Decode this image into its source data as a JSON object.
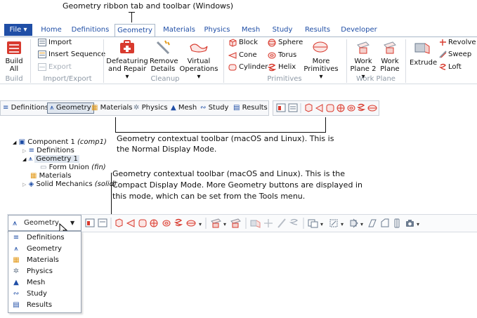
{
  "captions": {
    "top": "Geometry ribbon tab and toolbar (Windows)",
    "normal_line1": "Geometry contextual toolbar (macOS and Linux). This is",
    "normal_line2": "the Normal Display Mode.",
    "compact_line1": "Geometry contextual toolbar (macOS and Linux). This is the",
    "compact_line2": "Compact Display Mode. More Geometry buttons are displayed in",
    "compact_line3": "this mode, which can be set from the Tools menu."
  },
  "ribbon": {
    "file": "File ▾",
    "tabs": [
      "Home",
      "Definitions",
      "Geometry",
      "Materials",
      "Physics",
      "Mesh",
      "Study",
      "Results",
      "Developer"
    ],
    "build_all": [
      "Build",
      "All"
    ],
    "import": "Import",
    "insert_sequence": "Insert Sequence",
    "export": "Export",
    "defeaturing": [
      "Defeaturing",
      "and Repair ▾"
    ],
    "remove_details": [
      "Remove",
      "Details"
    ],
    "virtual_ops": [
      "Virtual",
      "Operations ▾"
    ],
    "block": "Block",
    "cone": "Cone",
    "cylinder": "Cylinder",
    "sphere": "Sphere",
    "torus": "Torus",
    "helix": "Helix",
    "more_primitives": [
      "More",
      "Primitives ▾"
    ],
    "work_plane_2": [
      "Work",
      "Plane 2 ▾"
    ],
    "work_plane": [
      "Work",
      "Plane"
    ],
    "extrude": "Extrude",
    "revolve": "Revolve",
    "sweep": "Sweep",
    "loft": "Loft",
    "groups": {
      "build": "Build",
      "import_export": "Import/Export",
      "cleanup": "Cleanup",
      "primitives": "Primitives",
      "work_plane": "Work Plane"
    }
  },
  "toolbar_normal": {
    "items": [
      "Definitions",
      "Geometry",
      "Materials",
      "Physics",
      "Mesh",
      "Study",
      "Results"
    ]
  },
  "tree": {
    "component": "Component 1",
    "component_tag": "(comp1)",
    "definitions": "Definitions",
    "geometry": "Geometry 1",
    "form_union": "Form Union",
    "form_union_tag": "(fin)",
    "materials": "Materials",
    "solid_mechanics": "Solid Mechanics",
    "solid_mechanics_tag": "(solid)"
  },
  "compact": {
    "dropdown": "Geometry",
    "menu": [
      "Definitions",
      "Geometry",
      "Materials",
      "Physics",
      "Mesh",
      "Study",
      "Results"
    ]
  },
  "colors": {
    "accent": "#1f4ea6",
    "red_icon": "#d83a2e",
    "orange": "#e39a1a",
    "selection": "#dfe6ef"
  }
}
